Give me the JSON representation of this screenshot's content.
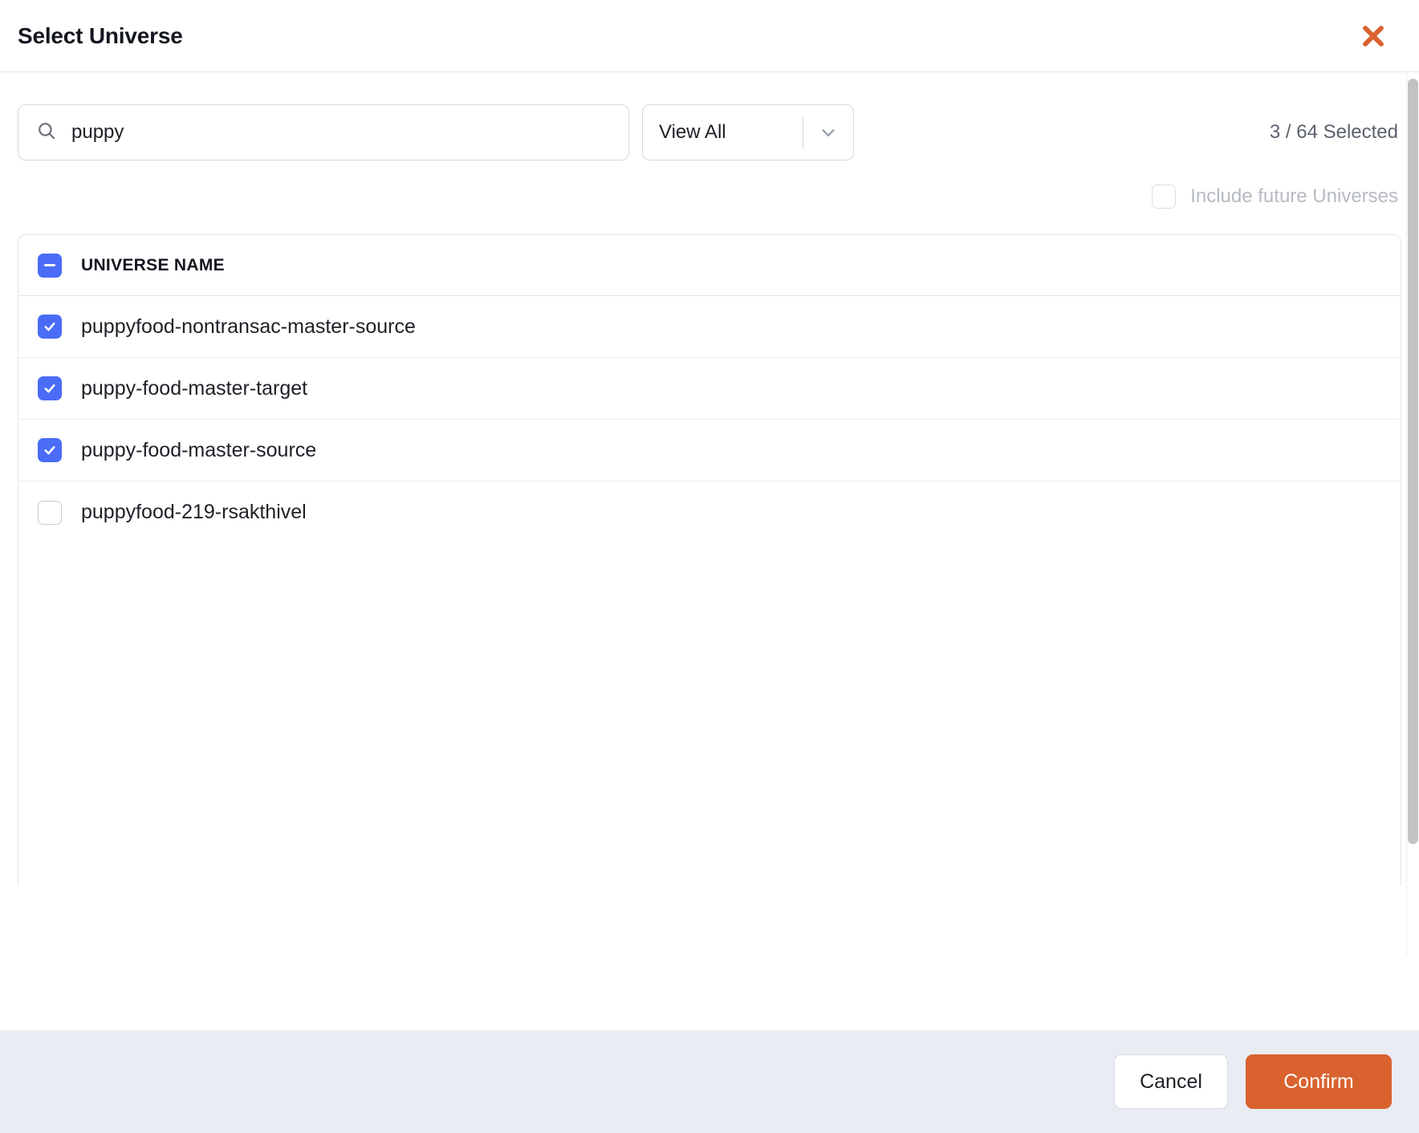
{
  "header": {
    "title": "Select Universe",
    "close_icon": "close-icon"
  },
  "controls": {
    "search": {
      "icon": "search-icon",
      "value": "puppy",
      "placeholder": "Search"
    },
    "view_filter": {
      "selected": "View All",
      "chevron_icon": "chevron-down-icon",
      "options": [
        "View All"
      ]
    },
    "selected_count": "3 / 64 Selected",
    "include_future": {
      "label": "Include future Universes",
      "checked": false,
      "disabled": true
    }
  },
  "table": {
    "header": {
      "column_label": "UNIVERSE NAME",
      "select_all_state": "indeterminate"
    },
    "rows": [
      {
        "name": "puppyfood-nontransac-master-source",
        "checked": true
      },
      {
        "name": "puppy-food-master-target",
        "checked": true
      },
      {
        "name": "puppy-food-master-source",
        "checked": true
      },
      {
        "name": "puppyfood-219-rsakthivel",
        "checked": false
      }
    ]
  },
  "footer": {
    "cancel_label": "Cancel",
    "confirm_label": "Confirm"
  },
  "colors": {
    "accent_orange": "#d9622f",
    "checkbox_blue": "#4a6cf7",
    "footer_bg": "#e9ecf2",
    "text_primary": "#1d2026",
    "text_muted": "#5c616e",
    "text_disabled": "#b6bac3"
  }
}
